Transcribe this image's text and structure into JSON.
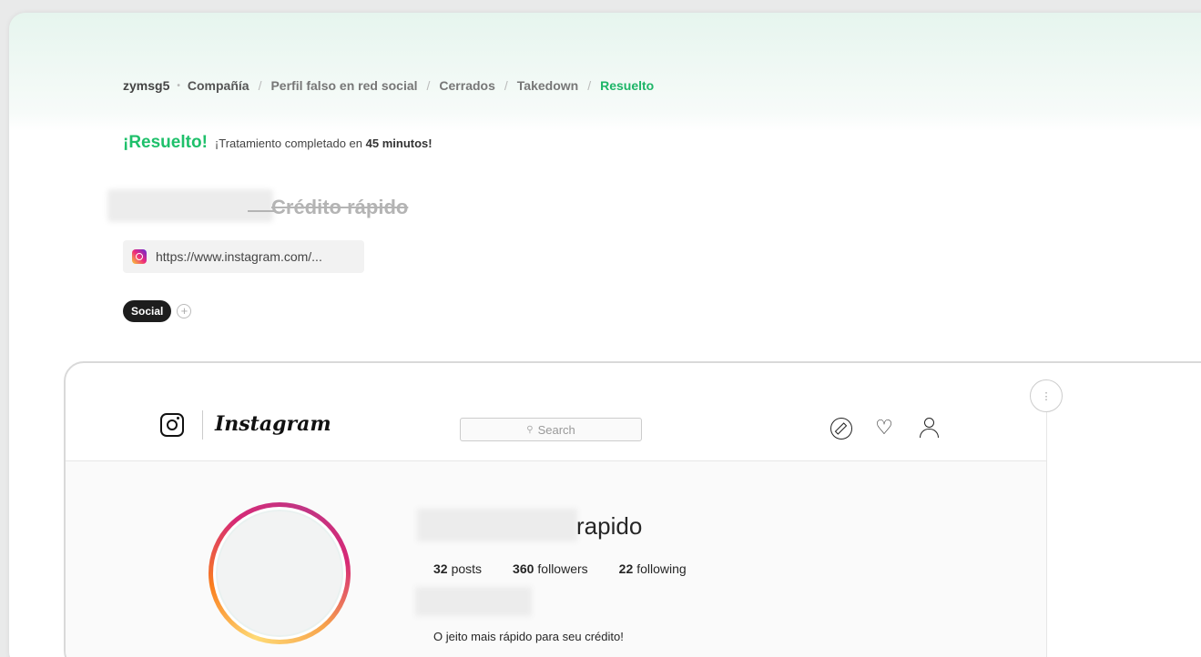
{
  "breadcrumb": {
    "user": "zymsg5",
    "items": [
      {
        "label": "Compañía",
        "style": "bold"
      },
      {
        "label": "Perfil falso en red social",
        "style": "grey"
      },
      {
        "label": "Cerrados",
        "style": "grey"
      },
      {
        "label": "Takedown",
        "style": "grey"
      },
      {
        "label": "Resuelto",
        "style": "green"
      }
    ]
  },
  "status": {
    "headline": "¡Resuelto!",
    "message_prefix": "¡Tratamiento completado en",
    "duration": "45 minutos!"
  },
  "case": {
    "title": "Crédito rápido",
    "url": "https://www.instagram.com/...",
    "tag": "Social",
    "add_tag_symbol": "+"
  },
  "instagram": {
    "wordmark": "Instagram",
    "search_placeholder": "Search",
    "search_glyph": "⚲",
    "menu_glyph": "⋮",
    "heart_glyph": "♡",
    "username_suffix": "rapido",
    "stats": [
      {
        "count": "32",
        "label": "posts"
      },
      {
        "count": "360",
        "label": "followers"
      },
      {
        "count": "22",
        "label": "following"
      }
    ],
    "bio": "O jeito mais rápido para seu crédito!"
  },
  "colors": {
    "accent_green": "#1fc06b",
    "tag_bg": "#1d1d1d"
  }
}
